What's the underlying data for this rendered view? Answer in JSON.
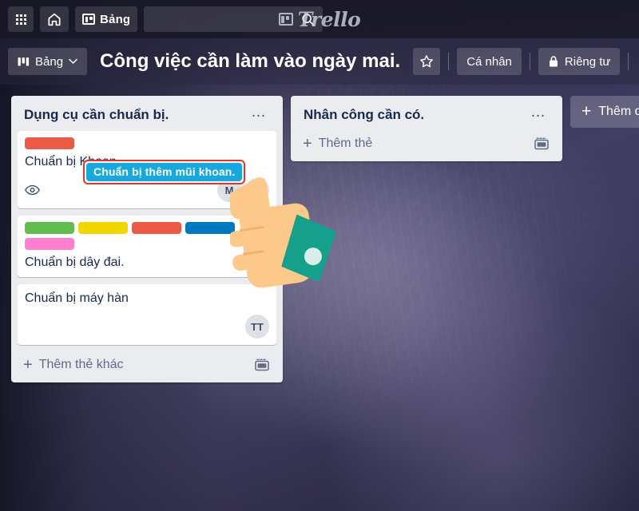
{
  "topnav": {
    "apps_label": "apps-grid",
    "home_label": "home",
    "boards_button_label": "Bảng",
    "search_placeholder": "",
    "search_value": "",
    "brand_name": "Trello"
  },
  "boardbar": {
    "view_button_label": "Bảng",
    "board_title": "Công việc cần làm vào ngày mai.",
    "star_label": "star",
    "workspace_label": "Cá nhân",
    "visibility_label": "Riêng tư"
  },
  "lists": [
    {
      "title": "Dụng cụ cần chuẩn bị.",
      "menu": "…",
      "add_card_label": "Thêm thẻ khác",
      "cards": [
        {
          "title": "Chuẩn bị Khoan.",
          "labels": [
            "#eb5a46"
          ],
          "watch_icon": "eye-icon",
          "members": [
            "M",
            "TT"
          ]
        },
        {
          "title": "Chuẩn bị dây đai.",
          "labels": [
            "#61bd4f",
            "#f2d600",
            "#eb5a46",
            "#0079bf",
            "#ff80ce"
          ],
          "watch_icon": "",
          "members": []
        },
        {
          "title": "Chuẩn bị máy hàn",
          "labels": [],
          "watch_icon": "",
          "members": [
            "TT"
          ]
        }
      ]
    },
    {
      "title": "Nhân công cần có.",
      "menu": "…",
      "add_card_label": "Thêm thẻ",
      "cards": []
    }
  ],
  "add_list_label": "Thêm danh sách khác",
  "tooltip": {
    "text": "Chuẩn bị thêm mũi khoan.",
    "background": "#16a9dd",
    "border": "#e8322b",
    "text_color": "#ffffff"
  },
  "cursor": {
    "type": "pointing-hand",
    "skin_color": "#fcc98a",
    "cuff_color": "#14a08b"
  },
  "colors": {
    "board_background": "#3b3757",
    "list_background": "#ebecf0",
    "card_background": "#ffffff",
    "title_text": "#172b4d",
    "muted_text": "#5e6c84"
  }
}
